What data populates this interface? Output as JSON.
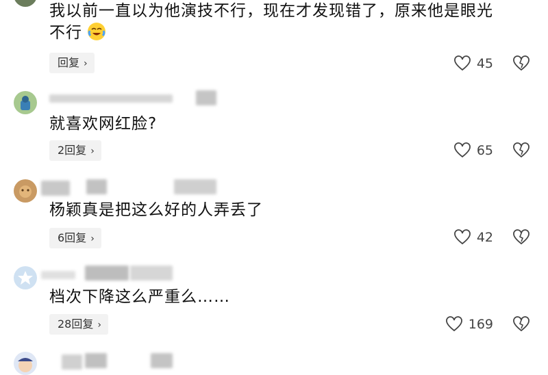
{
  "comments": [
    {
      "text_line1": "我以前一直以为他演技不行，现在才发现错了，原来他是眼光",
      "text_line2": "不行",
      "emoji": "laughing-crying-emoji",
      "reply_label": "回复",
      "likes": "45"
    },
    {
      "text": "就喜欢网红脸?",
      "reply_label": "2回复",
      "likes": "65"
    },
    {
      "text": "杨颖真是把这么好的人弄丢了",
      "reply_label": "6回复",
      "likes": "42"
    },
    {
      "text": "档次下降这么严重么……",
      "reply_label": "28回复",
      "likes": "169"
    }
  ],
  "icons": {
    "like": "heart-outline-icon",
    "dislike": "broken-heart-icon",
    "chevron": "chevron-right-icon"
  },
  "colors": {
    "reply_bg": "#f2f2f2",
    "text": "#111111",
    "icon": "#444444"
  }
}
